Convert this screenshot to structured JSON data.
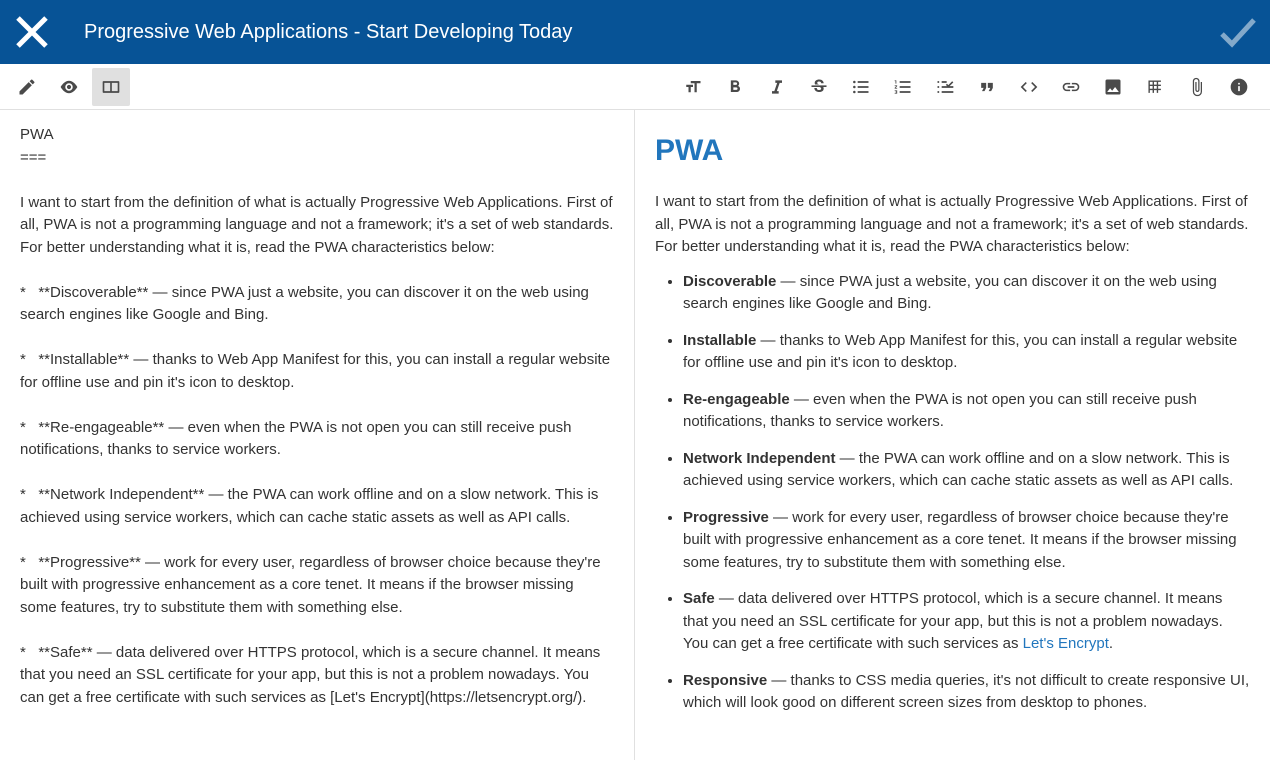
{
  "header": {
    "title": "Progressive Web Applications - Start Developing Today"
  },
  "source": {
    "heading": "PWA",
    "underline": "===",
    "intro": "I want to start from the definition of what is actually Progressive Web Applications. First of all, PWA is not a programming language and not a framework; it's a set of web standards. For better understanding what it is, read the PWA characteristics below:",
    "bullets": [
      {
        "name": "Discoverable",
        "text": " — since PWA just a website, you can discover it on the web using search engines like Google and Bing."
      },
      {
        "name": "Installable",
        "text": " — thanks to Web App Manifest for this, you can install a regular website for offline use and pin it's icon to desktop."
      },
      {
        "name": "Re-engageable",
        "text": " — even when the PWA is not open you can still receive push notifications, thanks to service workers."
      },
      {
        "name": "Network Independent",
        "text": " — the PWA can work offline and on a slow network. This is achieved using service workers, which can cache static assets as well as API calls."
      },
      {
        "name": "Progressive",
        "text": " — work for every user, regardless of browser choice because they're built with progressive enhancement as a core tenet. It means if the browser missing some features, try to substitute them with something else."
      },
      {
        "name": "Safe",
        "text": " — data delivered over HTTPS protocol, which is a secure channel. It means that you need an SSL certificate for your app, but this is not a problem nowadays. You can get a free certificate with such services as [Let's Encrypt](https://letsencrypt.org/)."
      }
    ]
  },
  "preview": {
    "heading": "PWA",
    "intro": "I want to start from the definition of what is actually Progressive Web Applications. First of all, PWA is not a programming language and not a framework; it's a set of web standards. For better understanding what it is, read the PWA characteristics below:",
    "items": [
      {
        "name": "Discoverable",
        "text": " — since PWA just a website, you can discover it on the web using search engines like Google and Bing."
      },
      {
        "name": "Installable",
        "text": " — thanks to Web App Manifest for this, you can install a regular website for offline use and pin it's icon to desktop."
      },
      {
        "name": "Re-engageable",
        "text": " — even when the PWA is not open you can still receive push notifications, thanks to service workers."
      },
      {
        "name": "Network Independent",
        "text": " — the PWA can work offline and on a slow network. This is achieved using service workers, which can cache static assets as well as API calls."
      },
      {
        "name": "Progressive",
        "text": " — work for every user, regardless of browser choice because they're built with progressive enhancement as a core tenet. It means if the browser missing some features, try to substitute them with something else."
      },
      {
        "name": "Safe",
        "text": " — data delivered over HTTPS protocol, which is a secure channel. It means that you need an SSL certificate for your app, but this is not a problem nowadays. You can get a free certificate with such services as ",
        "link_text": "Let's Encrypt",
        "text_after": "."
      },
      {
        "name": "Responsive",
        "text": " — thanks to CSS media queries, it's not difficult to create responsive UI, which will look good on different screen sizes from desktop to phones."
      }
    ]
  }
}
